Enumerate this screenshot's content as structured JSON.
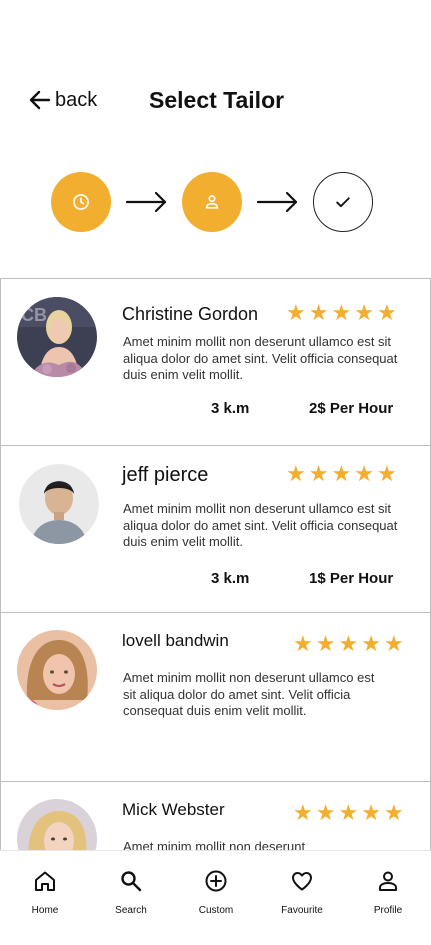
{
  "header": {
    "back_label": "back",
    "title": "Select Tailor"
  },
  "steps": [
    {
      "icon": "clock-icon",
      "state": "active"
    },
    {
      "icon": "person-icon",
      "state": "active"
    },
    {
      "icon": "check-icon",
      "state": "pending"
    }
  ],
  "accent_color": "#f2ae2e",
  "tailors": [
    {
      "name": "Christine Gordon",
      "rating": 5,
      "description": "Amet minim mollit non deserunt ullamco est sit aliqua dolor do amet sint. Velit officia consequat duis enim velit mollit.",
      "distance": "3 k.m",
      "price": "2$ Per Hour"
    },
    {
      "name": "jeff pierce",
      "rating": 5,
      "description": "Amet minim mollit non deserunt ullamco est sit aliqua dolor do amet sint. Velit officia consequat duis enim velit mollit.",
      "distance": "3 k.m",
      "price": "1$ Per Hour"
    },
    {
      "name": "lovell bandwin",
      "rating": 5,
      "description": "Amet minim mollit non deserunt ullamco est sit aliqua dolor do amet sint. Velit officia consequat duis enim velit mollit."
    },
    {
      "name": "Mick Webster",
      "rating": 5,
      "description": "Amet minim mollit non deserunt"
    }
  ],
  "nav": {
    "items": [
      {
        "label": "Home",
        "icon": "home-icon"
      },
      {
        "label": "Search",
        "icon": "search-icon"
      },
      {
        "label": "Custom",
        "icon": "plus-circle-icon"
      },
      {
        "label": "Favourite",
        "icon": "heart-icon"
      },
      {
        "label": "Profile",
        "icon": "profile-icon"
      }
    ]
  }
}
